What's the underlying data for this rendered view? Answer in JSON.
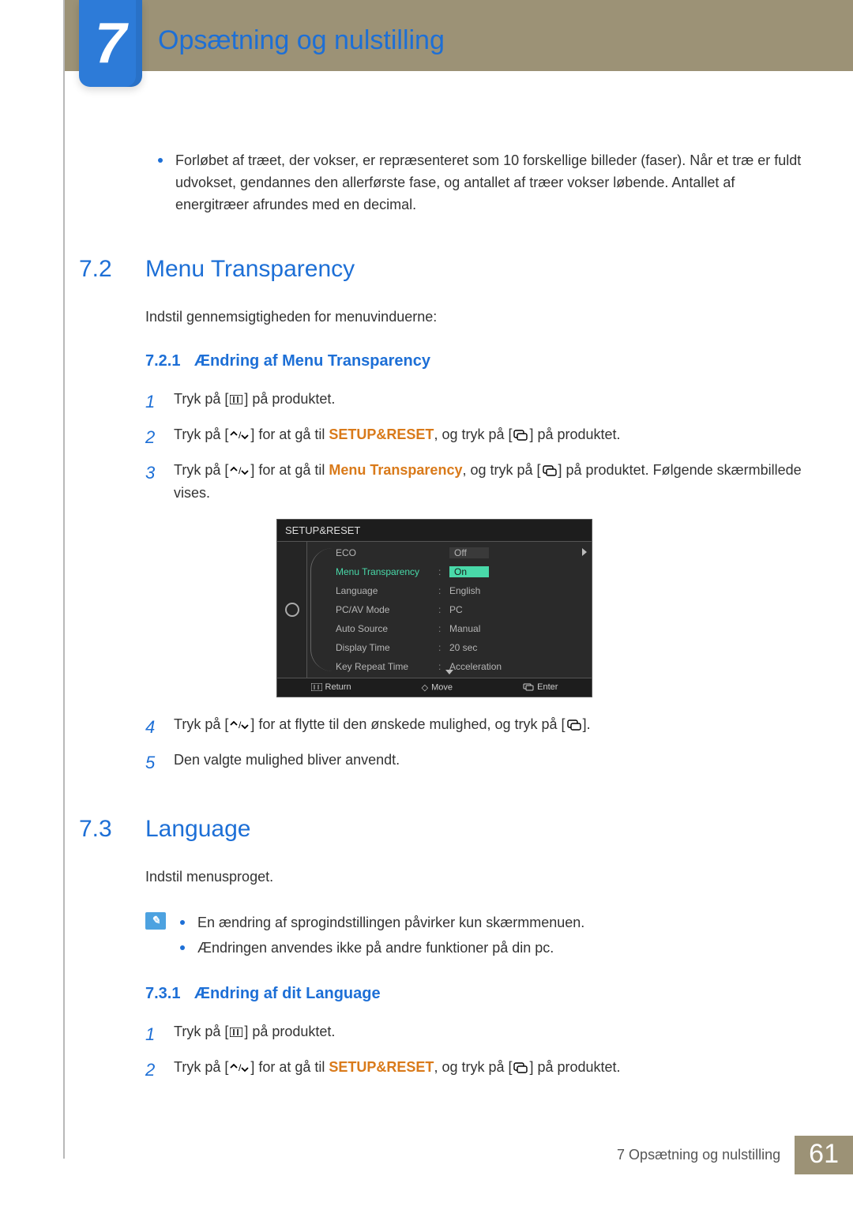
{
  "chapter": {
    "number": "7",
    "title": "Opsætning og nulstilling"
  },
  "intro_bullet": "Forløbet af træet, der vokser, er repræsenteret som 10 forskellige billeder (faser). Når et træ er fuldt udvokset, gendannes den allerførste fase, og antallet af træer vokser løbende. Antallet af energitræer afrundes med en decimal.",
  "s72": {
    "num": "7.2",
    "title": "Menu Transparency",
    "desc": "Indstil gennemsigtigheden for menuvinduerne:",
    "sub": {
      "num": "7.2.1",
      "title": "Ændring af Menu Transparency"
    },
    "steps": {
      "s1_a": "Tryk på [",
      "s1_b": "] på produktet.",
      "s2_a": "Tryk på [",
      "s2_b": "] for at gå til ",
      "s2_target": "SETUP&RESET",
      "s2_c": ", og tryk på [",
      "s2_d": "] på produktet.",
      "s3_a": "Tryk på [",
      "s3_b": "] for at gå til ",
      "s3_target": "Menu Transparency",
      "s3_c": ", og tryk på [",
      "s3_d": "] på produktet. Følgende skærmbillede vises.",
      "s4_a": "Tryk på [",
      "s4_b": "] for at flytte til den ønskede mulighed, og tryk på [",
      "s4_c": "].",
      "s5": "Den valgte mulighed bliver anvendt."
    }
  },
  "osd": {
    "title": "SETUP&RESET",
    "rows": {
      "eco": {
        "label": "ECO",
        "value": ""
      },
      "trans": {
        "label": "Menu Transparency",
        "off": "Off",
        "on": "On"
      },
      "lang": {
        "label": "Language",
        "value": "English"
      },
      "pcav": {
        "label": "PC/AV Mode",
        "value": "PC"
      },
      "autosrc": {
        "label": "Auto Source",
        "value": "Manual"
      },
      "disptime": {
        "label": "Display Time",
        "value": "20 sec"
      },
      "keyrep": {
        "label": "Key Repeat Time",
        "value": "Acceleration"
      }
    },
    "footer": {
      "return": "Return",
      "move": "Move",
      "enter": "Enter"
    }
  },
  "s73": {
    "num": "7.3",
    "title": "Language",
    "desc": "Indstil menusproget.",
    "notes": {
      "n1": "En ændring af sprogindstillingen påvirker kun skærmmenuen.",
      "n2": "Ændringen anvendes ikke på andre funktioner på din pc."
    },
    "sub": {
      "num": "7.3.1",
      "title": "Ændring af dit Language"
    },
    "steps": {
      "s1_a": "Tryk på [",
      "s1_b": "] på produktet.",
      "s2_a": "Tryk på [",
      "s2_b": "] for at gå til ",
      "s2_target": "SETUP&RESET",
      "s2_c": ", og tryk på [",
      "s2_d": "] på produktet."
    }
  },
  "footer": {
    "crumb": "7 Opsætning og nulstilling",
    "page": "61"
  }
}
